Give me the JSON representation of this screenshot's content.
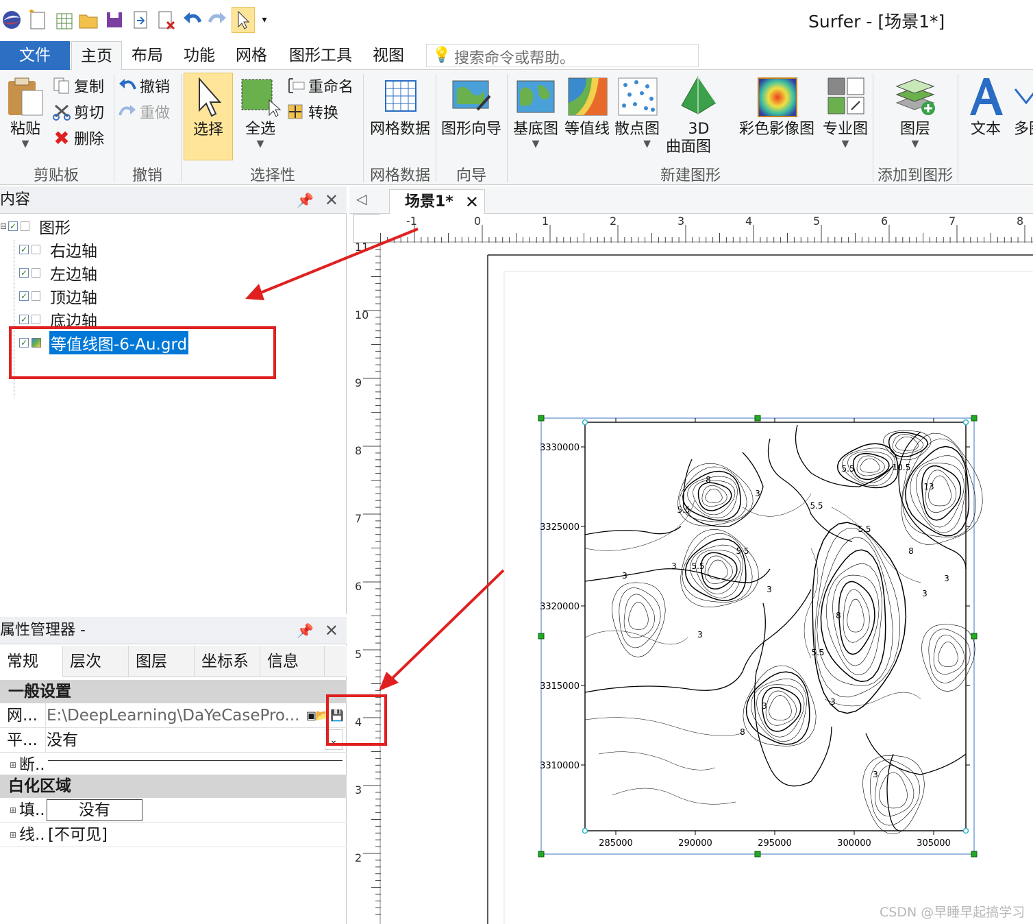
{
  "window": {
    "title": "Surfer - [场景1*]"
  },
  "quick_access": [
    "app-icon",
    "new-plot-icon",
    "new-worksheet-icon",
    "open-icon",
    "save-icon",
    "export-icon",
    "close-icon",
    "undo-icon",
    "redo-icon",
    "select-icon",
    "customize-dropdown-icon"
  ],
  "tabs": {
    "file": "文件",
    "items": [
      "主页",
      "布局",
      "功能",
      "网格",
      "图形工具",
      "视图"
    ],
    "active": "主页"
  },
  "search": {
    "placeholder": "搜索命令或帮助。"
  },
  "ribbon": {
    "clipboard": {
      "label": "剪贴板",
      "paste": "粘贴",
      "copy": "复制",
      "cut": "剪切",
      "delete": "删除"
    },
    "undo": {
      "label": "撤销",
      "undo": "撤销",
      "redo": "重做"
    },
    "selection": {
      "label": "选择性",
      "select": "选择",
      "select_all": "全选",
      "rename": "重命名",
      "transform": "转换"
    },
    "grid_data": {
      "label": "网格数据",
      "button": "网格数据"
    },
    "wizard": {
      "label": "向导",
      "button": "图形向导"
    },
    "new_map": {
      "label": "新建图形",
      "base": "基底图",
      "contour": "等值线",
      "post": "散点图",
      "surface_line1": "3D",
      "surface_line2": "曲面图",
      "color_relief": "彩色影像图",
      "specialty": "专业图"
    },
    "add_to_map": {
      "label": "添加到图形",
      "layer": "图层"
    },
    "text": {
      "button": "文本",
      "more": "多图"
    }
  },
  "contents_panel": {
    "title": "内容",
    "tree": {
      "root": "图形",
      "children": [
        "右边轴",
        "左边轴",
        "顶边轴",
        "底边轴"
      ],
      "selected": "等值线图-6-Au.grd"
    }
  },
  "property_manager": {
    "title": "属性管理器 -",
    "tabs": [
      "常规",
      "层次",
      "图层",
      "坐标系",
      "信息"
    ],
    "sections": {
      "general": "一般设置",
      "blanking": "白化区域"
    },
    "rows": {
      "grid_file_name": "网...",
      "grid_file_value": "E:\\DeepLearning\\DaYeCasePro...",
      "smoothing_name": "平...",
      "smoothing_value": "没有",
      "fault_name": "断..",
      "fill_name": "填..",
      "fill_value": "没有",
      "line_name": "线..",
      "line_value": "[不可见]"
    }
  },
  "document": {
    "tab": "场景1*",
    "hruler_labels": [
      "-1",
      "0",
      "1",
      "2",
      "3",
      "4",
      "5",
      "6",
      "7",
      "8"
    ],
    "vruler_labels": [
      "11",
      "10",
      "9",
      "8",
      "7",
      "6",
      "5",
      "4",
      "3",
      "2"
    ]
  },
  "map": {
    "x_ticks": [
      "285000",
      "290000",
      "295000",
      "300000",
      "305000"
    ],
    "y_ticks": [
      "3330000",
      "3325000",
      "3320000",
      "3315000",
      "3310000"
    ],
    "contour_labels": [
      "8",
      "5.5",
      "3",
      "3",
      "5.5",
      "5.5",
      "8",
      "10.5",
      "13",
      "8",
      "5.5",
      "3",
      "5.5",
      "3",
      "3",
      "8",
      "3",
      "5.5",
      "5.5",
      "3",
      "3",
      "3",
      "3"
    ]
  },
  "colors": {
    "file_tab": "#2d6fc3",
    "select_highlight": "#ffe59a",
    "annotation_red": "#e02020",
    "tree_selection": "#0078d7"
  },
  "watermark": "CSDN @早睡早起搞学习"
}
